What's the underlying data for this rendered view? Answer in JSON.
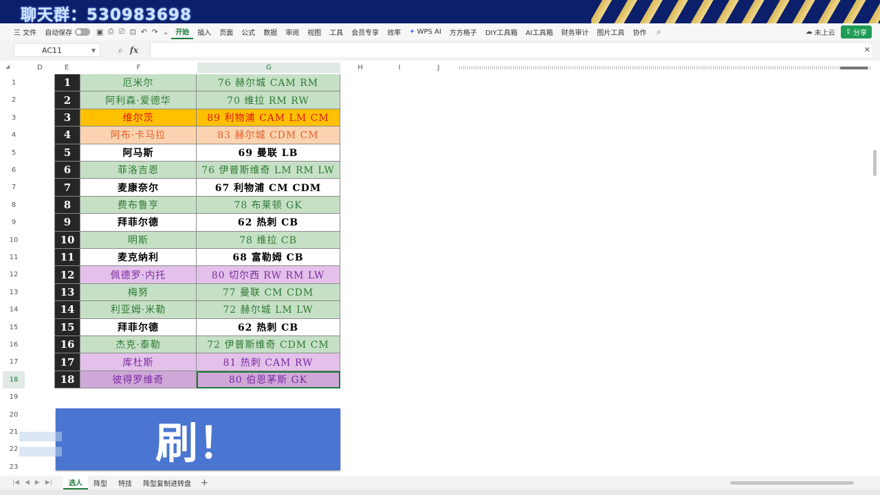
{
  "banner": {
    "text": "聊天群：530983698"
  },
  "ribbon": {
    "file_label": "三 文件",
    "autosave_label": "自动保存",
    "tabs": [
      "开始",
      "插入",
      "页面",
      "公式",
      "数据",
      "审阅",
      "视图",
      "工具",
      "会员专享",
      "效率",
      "WPS AI",
      "方方格子",
      "DIY工具箱",
      "AI工具箱",
      "财务审计",
      "图片工具",
      "协作"
    ],
    "active_tab": "开始",
    "cloud_label": "未上云",
    "share_label": "分享"
  },
  "formula_bar": {
    "cell_ref": "AC11",
    "fx_label": "fx",
    "content": ""
  },
  "columns": [
    "D",
    "E",
    "F",
    "G",
    "H",
    "I",
    "J"
  ],
  "row_numbers": [
    "1",
    "2",
    "3",
    "4",
    "5",
    "6",
    "7",
    "8",
    "9",
    "10",
    "11",
    "12",
    "13",
    "14",
    "15",
    "16",
    "17",
    "18",
    "19",
    "20",
    "21",
    "22",
    "23"
  ],
  "players": [
    {
      "no": "1",
      "name": "厄米尔",
      "info": "76 赫尔城 CAM RM",
      "style": "green"
    },
    {
      "no": "2",
      "name": "阿利森·爱德华",
      "info": "70 维拉 RM RW",
      "style": "green"
    },
    {
      "no": "3",
      "name": "维尔茨",
      "info": "89 利物浦 CAM LM CM",
      "style": "gold"
    },
    {
      "no": "4",
      "name": "阿布·卡马拉",
      "info": "83 赫尔城 CDM CM",
      "style": "peach"
    },
    {
      "no": "5",
      "name": "阿马斯",
      "info": "69 曼联 LB",
      "style": "white"
    },
    {
      "no": "6",
      "name": "菲洛吉恩",
      "info": "76 伊普斯维奇 LM RM LW",
      "style": "green"
    },
    {
      "no": "7",
      "name": "麦康奈尔",
      "info": "67 利物浦 CM CDM",
      "style": "white"
    },
    {
      "no": "8",
      "name": "费布鲁亨",
      "info": "78 布莱顿 GK",
      "style": "green"
    },
    {
      "no": "9",
      "name": "拜菲尔德",
      "info": "62 热刺 CB",
      "style": "white"
    },
    {
      "no": "10",
      "name": "明斯",
      "info": "78 维拉 CB",
      "style": "green"
    },
    {
      "no": "11",
      "name": "麦克纳利",
      "info": "68 富勒姆 CB",
      "style": "white"
    },
    {
      "no": "12",
      "name": "佩德罗·内托",
      "info": "80 切尔西 RW RM LW",
      "style": "purple"
    },
    {
      "no": "13",
      "name": "梅努",
      "info": "77 曼联 CM CDM",
      "style": "green"
    },
    {
      "no": "14",
      "name": "利亚姆·米勒",
      "info": "72 赫尔城 LM LW",
      "style": "green"
    },
    {
      "no": "15",
      "name": "拜菲尔德",
      "info": "62 热刺 CB",
      "style": "white"
    },
    {
      "no": "16",
      "name": "杰克·泰勒",
      "info": "72 伊普斯维奇 CDM CM",
      "style": "green"
    },
    {
      "no": "17",
      "name": "库杜斯",
      "info": "81 热刺 CAM RW",
      "style": "purple"
    },
    {
      "no": "18",
      "name": "彼得罗维奇",
      "info": "80 伯恩茅斯 GK",
      "style": "purple-dark"
    }
  ],
  "refresh_banner": {
    "text": "刷！"
  },
  "sheet_tabs": {
    "tabs": [
      "选人",
      "阵型",
      "特技",
      "阵型复制进转盘"
    ],
    "active": "选人",
    "add_label": "+"
  },
  "colors": {
    "accent": "#1a7a3c",
    "green_fill": "#c6e0c6",
    "gold_fill": "#ffc000",
    "peach_fill": "#fbd3b0",
    "purple_fill": "#e3c1ea",
    "banner_blue": "#4a75d0"
  }
}
